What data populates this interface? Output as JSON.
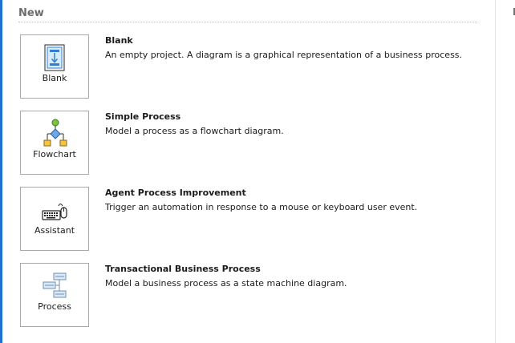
{
  "section": {
    "title": "New"
  },
  "templates": [
    {
      "tile_label": "Blank",
      "name": "Blank",
      "description": "An empty project. A diagram is a graphical representation of a business process.",
      "icon": "blank-document-icon"
    },
    {
      "tile_label": "Flowchart",
      "name": "Simple Process",
      "description": "Model a process as a flowchart diagram.",
      "icon": "flowchart-icon"
    },
    {
      "tile_label": "Assistant",
      "name": "Agent Process Improvement",
      "description": "Trigger an automation in response to a mouse or keyboard user event.",
      "icon": "keyboard-mouse-icon"
    },
    {
      "tile_label": "Process",
      "name": "Transactional Business Process",
      "description": "Model a business process as a state machine diagram.",
      "icon": "state-machine-icon"
    }
  ],
  "colors": {
    "accent": "#1e6fd0",
    "tile_border": "#a9a9a9",
    "section_title": "#6b6b6b",
    "text": "#1b1b1b"
  }
}
